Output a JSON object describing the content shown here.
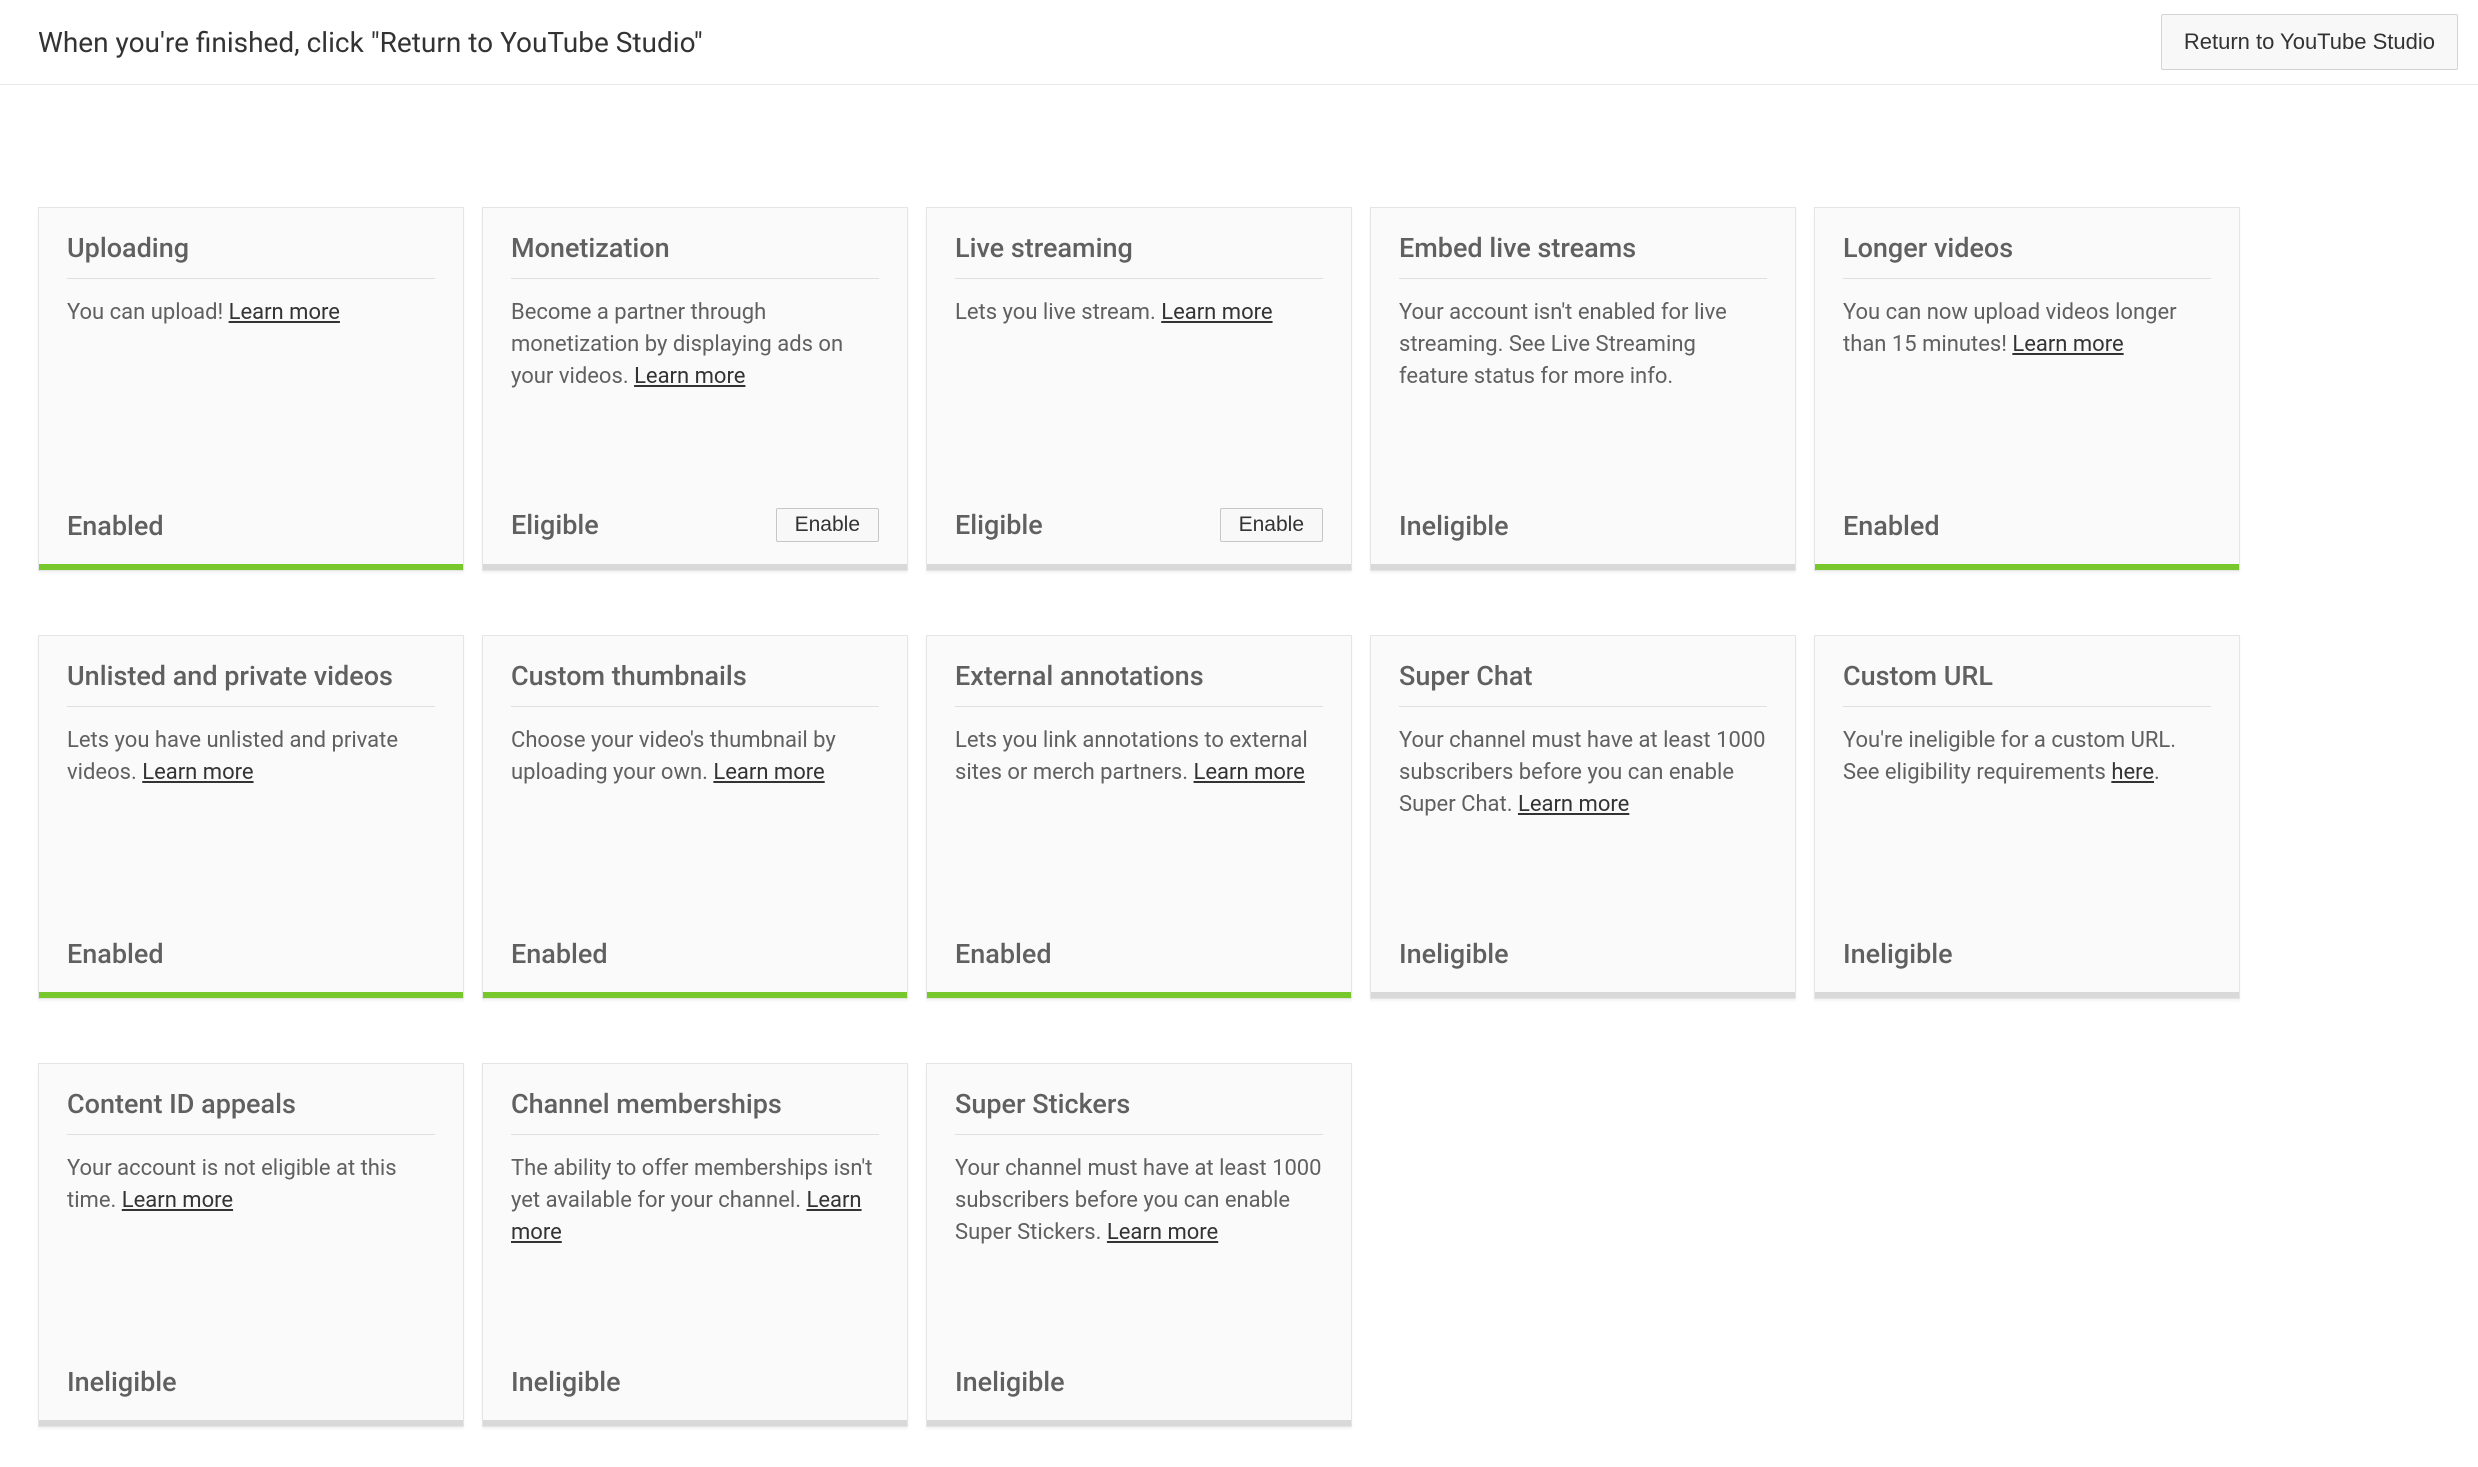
{
  "header": {
    "title": "When you're finished, click \"Return to YouTube Studio\"",
    "return_button": "Return to YouTube Studio"
  },
  "statuses": {
    "enabled": "Enabled",
    "eligible": "Eligible",
    "ineligible": "Ineligible"
  },
  "buttons": {
    "enable": "Enable"
  },
  "links": {
    "learn_more": "Learn more",
    "here": "here"
  },
  "cards": [
    {
      "id": "uploading",
      "title": "Uploading",
      "desc_pre": "You can upload! ",
      "link": "Learn more",
      "desc_post": "",
      "status": "Enabled",
      "has_button": false,
      "bar": "enabled"
    },
    {
      "id": "monetization",
      "title": "Monetization",
      "desc_pre": "Become a partner through monetization by displaying ads on your videos. ",
      "link": "Learn more",
      "desc_post": "",
      "status": "Eligible",
      "has_button": true,
      "bar": "other"
    },
    {
      "id": "live-streaming",
      "title": "Live streaming",
      "desc_pre": "Lets you live stream. ",
      "link": "Learn more",
      "desc_post": "",
      "status": "Eligible",
      "has_button": true,
      "bar": "other"
    },
    {
      "id": "embed-live-streams",
      "title": "Embed live streams",
      "desc_pre": "Your account isn't enabled for live streaming. See Live Streaming feature status for more info.",
      "link": "",
      "desc_post": "",
      "status": "Ineligible",
      "has_button": false,
      "bar": "other"
    },
    {
      "id": "longer-videos",
      "title": "Longer videos",
      "desc_pre": "You can now upload videos longer than 15 minutes! ",
      "link": "Learn more",
      "desc_post": "",
      "status": "Enabled",
      "has_button": false,
      "bar": "enabled"
    },
    {
      "id": "unlisted-private",
      "title": "Unlisted and private videos",
      "desc_pre": "Lets you have unlisted and private videos. ",
      "link": "Learn more",
      "desc_post": "",
      "status": "Enabled",
      "has_button": false,
      "bar": "enabled"
    },
    {
      "id": "custom-thumbnails",
      "title": "Custom thumbnails",
      "desc_pre": "Choose your video's thumbnail by uploading your own. ",
      "link": "Learn more",
      "desc_post": "",
      "status": "Enabled",
      "has_button": false,
      "bar": "enabled"
    },
    {
      "id": "external-annotations",
      "title": "External annotations",
      "desc_pre": "Lets you link annotations to external sites or merch partners. ",
      "link": "Learn more",
      "desc_post": "",
      "status": "Enabled",
      "has_button": false,
      "bar": "enabled"
    },
    {
      "id": "super-chat",
      "title": "Super Chat",
      "desc_pre": "Your channel must have at least 1000 subscribers before you can enable Super Chat. ",
      "link": "Learn more",
      "desc_post": "",
      "status": "Ineligible",
      "has_button": false,
      "bar": "other"
    },
    {
      "id": "custom-url",
      "title": "Custom URL",
      "desc_pre": "You're ineligible for a custom URL. See eligibility requirements ",
      "link": "here",
      "desc_post": ".",
      "status": "Ineligible",
      "has_button": false,
      "bar": "other"
    },
    {
      "id": "content-id-appeals",
      "title": "Content ID appeals",
      "desc_pre": "Your account is not eligible at this time. ",
      "link": "Learn more",
      "desc_post": "",
      "status": "Ineligible",
      "has_button": false,
      "bar": "other"
    },
    {
      "id": "channel-memberships",
      "title": "Channel memberships",
      "desc_pre": "The ability to offer memberships isn't yet available for your channel. ",
      "link": "Learn more",
      "desc_post": "",
      "status": "Ineligible",
      "has_button": false,
      "bar": "other"
    },
    {
      "id": "super-stickers",
      "title": "Super Stickers",
      "desc_pre": "Your channel must have at least 1000 subscribers before you can enable Super Stickers. ",
      "link": "Learn more",
      "desc_post": "",
      "status": "Ineligible",
      "has_button": false,
      "bar": "other"
    }
  ]
}
